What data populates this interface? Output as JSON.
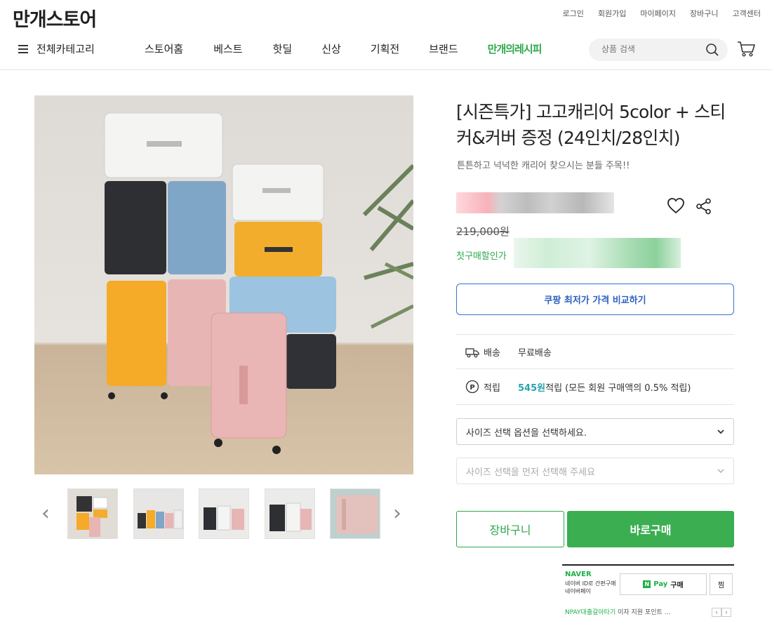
{
  "brand": {
    "logo": "만개스토어"
  },
  "top_links": [
    "로그인",
    "회원가입",
    "마이페이지",
    "장바구니",
    "고객센터"
  ],
  "nav": {
    "all_categories": "전체카테고리",
    "items": [
      "스토어홈",
      "베스트",
      "핫딜",
      "신상",
      "기획전",
      "브랜드"
    ],
    "recipe": "만개의레시피"
  },
  "search": {
    "placeholder": "상품 검색"
  },
  "product": {
    "title": "[시즌특가] 고고캐리어 5color + 스티커&커버 증정 (24인치/28인치)",
    "subtitle": "튼튼하고 넉넉한 캐리어 찾으시는 분들 주목!!",
    "original_price": "219,000원",
    "first_purchase_label": "첫구매할인가",
    "compare_button": "쿠팡 최저가 가격 비교하기",
    "shipping_label": "배송",
    "shipping_value": "무료배송",
    "points_label": "적립",
    "points_value": "545원",
    "points_text": " 적립 (모든 회원 구매액의 0.5% 적립)",
    "option1_placeholder": "사이즈 선택 옵션을 선택하세요.",
    "option2_placeholder": "사이즈 선택을 먼저 선택해 주세요",
    "cart_button": "장바구니",
    "buy_button": "바로구매"
  },
  "npay": {
    "naver": "NAVER",
    "desc_line1": "네이버 ID로 간편구매",
    "desc_line2": "네이버페이",
    "n_badge": "N",
    "pay": "Pay",
    "buy": "구매",
    "zzim": "찜",
    "bottom_green": "NPAY대출갈아타기",
    "bottom_text": " 이자 지원 포인트 …"
  },
  "colors": {
    "green": "#3bae52",
    "blue": "#3a6fd1",
    "point": "#2ea2b0"
  }
}
